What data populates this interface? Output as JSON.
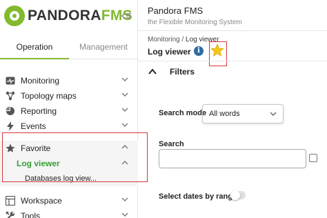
{
  "logo": {
    "brand_main": "PANDORA",
    "brand_accent": "FMS"
  },
  "sidebar": {
    "tabs": [
      {
        "label": "Operation",
        "active": true
      },
      {
        "label": "Management",
        "active": false
      }
    ],
    "items": [
      {
        "label": "Monitoring",
        "icon": "monitoring-icon"
      },
      {
        "label": "Topology maps",
        "icon": "topology-icon"
      },
      {
        "label": "Reporting",
        "icon": "reporting-icon"
      },
      {
        "label": "Events",
        "icon": "events-icon"
      },
      {
        "label": "Favorite",
        "icon": "star-icon",
        "expanded": true
      },
      {
        "label": "Workspace",
        "icon": "workspace-icon"
      },
      {
        "label": "Tools",
        "icon": "tools-icon"
      }
    ],
    "favorite_sub": {
      "label": "Log viewer",
      "child": "Databases log view..."
    }
  },
  "header": {
    "title": "Pandora FMS",
    "subtitle": "the Flexible Monitoring System"
  },
  "breadcrumb": {
    "parent": "Monitoring",
    "separator": " / ",
    "current": "Log viewer"
  },
  "page": {
    "title": "Log viewer"
  },
  "filters": {
    "heading": "Filters",
    "search_mode_label": "Search mode",
    "search_mode_value": "All words",
    "search_label": "Search",
    "search_value": "",
    "dates_label": "Select dates by range"
  },
  "colors": {
    "brand": "#82b92e",
    "highlight": "#d8363a",
    "link_active": "#33a033",
    "info": "#2d6ea3",
    "star": "#f5c518"
  }
}
